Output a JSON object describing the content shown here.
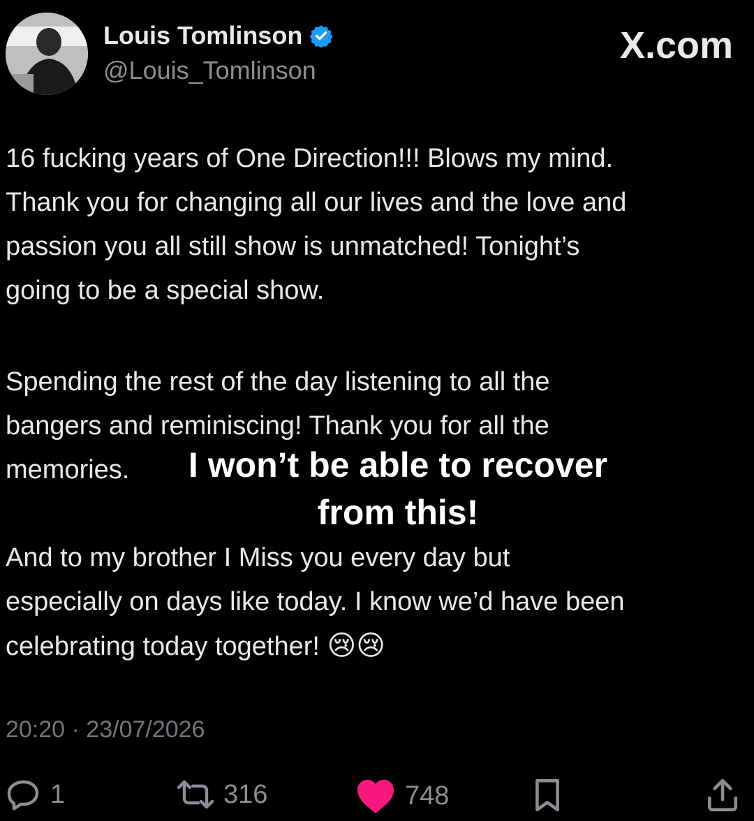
{
  "user": {
    "display_name": "Louis Tomlinson",
    "handle": "@Louis_Tomlinson",
    "verified": true
  },
  "brand": "X.com",
  "tweet": {
    "paragraph1": [
      "16 fucking years of One Direction!!! Blows my mind.",
      "Thank you for changing all our lives and the love and",
      "passion you all still show is unmatched! Tonight’s",
      "going to be a special show."
    ],
    "paragraph2": [
      "Spending the rest of the day listening to all the",
      "bangers and reminiscing! Thank you for all the",
      "memories."
    ],
    "paragraph3": [
      "And to my brother I Miss you every day but",
      "especially on days like today. I know we’d have been",
      "celebrating today together!"
    ],
    "emoji": "😢😢",
    "timestamp": "20:20 · 23/07/2026"
  },
  "overlay_text": {
    "line1": "I won’t be able to recover",
    "line2": "from this!"
  },
  "actions": {
    "reply_count": "1",
    "repost_count": "316",
    "like_count": "748"
  },
  "colors": {
    "background": "#000000",
    "text": "#e7e9ea",
    "secondary": "#71767b",
    "verified": "#1d9bf0",
    "like": "#f91880"
  }
}
